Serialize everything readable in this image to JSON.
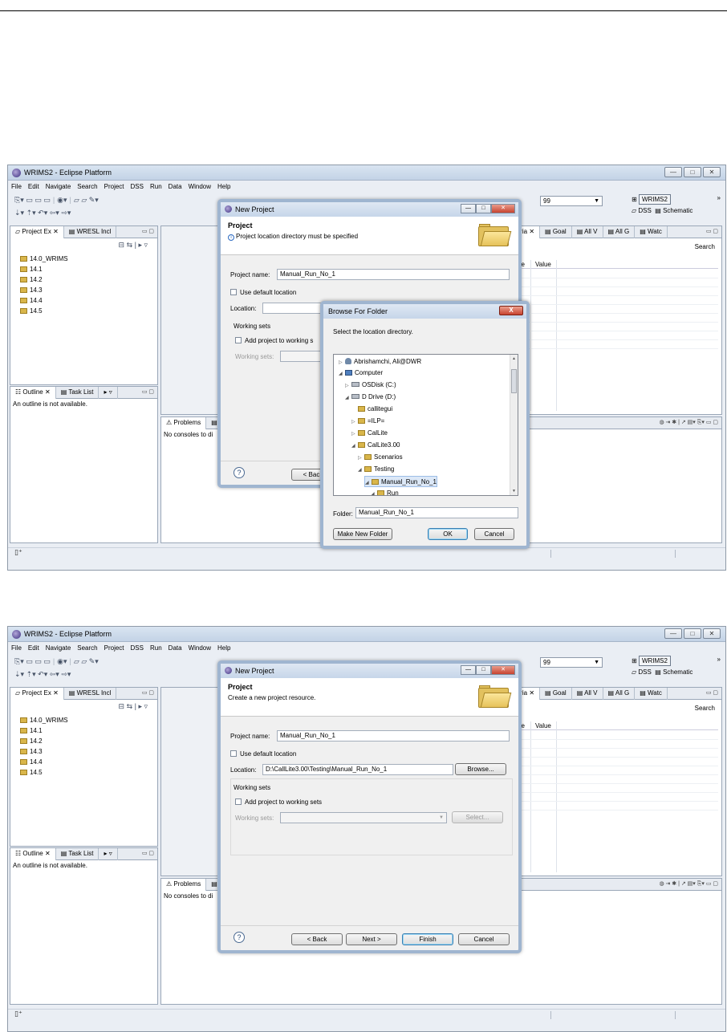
{
  "window": {
    "title": "WRIMS2 - Eclipse Platform",
    "menu": [
      "File",
      "Edit",
      "Navigate",
      "Search",
      "Project",
      "DSS",
      "Run",
      "Data",
      "Window",
      "Help"
    ],
    "min": "—",
    "max": "□",
    "close": "✕"
  },
  "toolbar": {
    "combo_value": "99",
    "perspective": "WRIMS2",
    "dss": "DSS",
    "schematic": "Schematic",
    "chevron": "»"
  },
  "project_view": {
    "tabs": [
      "Project Ex",
      "WRESL Incl"
    ],
    "items": [
      "14.0_WRIMS",
      "14.1",
      "14.2",
      "14.3",
      "14.4",
      "14.5"
    ]
  },
  "outline_view": {
    "tabs": [
      "Outline",
      "Task List"
    ],
    "message": "An outline is not available."
  },
  "variable_view": {
    "tabs": [
      "Varia",
      "Goal",
      "All V",
      "All G",
      "Watc"
    ],
    "search": "Search",
    "col1": "iable",
    "col2": "Value"
  },
  "console_view": {
    "tab": "Problems",
    "message": "No consoles to di"
  },
  "new_project": {
    "title": "New Project",
    "heading": "Project",
    "message1": "Project location directory must be specified",
    "message2": "Create a new project resource.",
    "project_name_label": "Project name:",
    "project_name": "Manual_Run_No_1",
    "use_default": "Use default location",
    "location_label": "Location:",
    "location_value": "D:\\CallLite3.00\\Testing\\Manual_Run_No_1",
    "browse": "Browse...",
    "working_sets": "Working sets",
    "add_to_ws": "Add project to working sets",
    "add_to_ws_cut": "Add project to working s",
    "ws_label": "Working sets:",
    "select": "Select...",
    "help": "?",
    "back": "< Back",
    "back_cut": "< Bac",
    "next": "Next >",
    "finish": "Finish",
    "cancel": "Cancel"
  },
  "browse_folder": {
    "title": "Browse For Folder",
    "close": "X",
    "instruction": "Select the location directory.",
    "tree": [
      "Abrishamchi, Ali@DWR",
      "Computer",
      "OSDisk (C:)",
      "D Drive (D:)",
      "callitegui",
      "=ILP=",
      "CalLite",
      "CalLite3.00",
      "Scenarios",
      "Testing",
      "Manual_Run_No_1",
      "Run"
    ],
    "folder_label": "Folder:",
    "folder_value": "Manual_Run_No_1",
    "make_new": "Make New Folder",
    "ok": "OK",
    "cancel": "Cancel"
  }
}
